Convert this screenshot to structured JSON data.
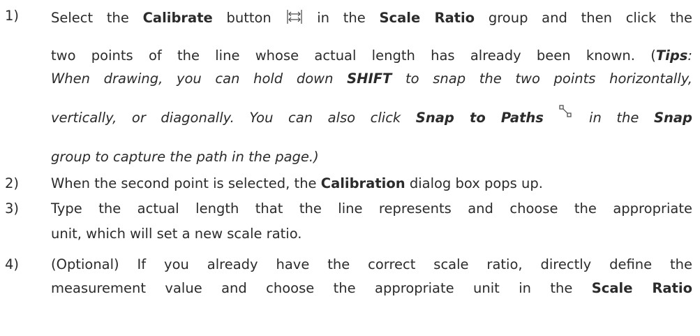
{
  "steps": [
    {
      "number": "1)",
      "line1": {
        "pre": "Select the ",
        "bold1": "Calibrate",
        "mid1": " button",
        "icon": "calibrate-icon",
        "mid2": " in the ",
        "bold2": "Scale Ratio",
        "post": " group and then click the"
      },
      "line2": {
        "text": "two points of the line whose actual length has already been known. (",
        "tips_label": "Tips",
        "tips_colon": ":"
      },
      "line3": {
        "pre": "When drawing, you can hold down ",
        "bold": "SHIFT",
        "post": " to snap the two points horizontally,"
      },
      "line4": {
        "pre": "vertically, or diagonally. You can also click ",
        "bold1": "Snap to Paths",
        "icon": "snap-to-paths-icon",
        "mid": " in the ",
        "bold2": "Snap"
      },
      "line5": {
        "text": "group to capture the path in the page.)"
      }
    },
    {
      "number": "2)",
      "line1": {
        "pre": "When the second point is selected, the ",
        "bold": "Calibration",
        "post": " dialog box pops up."
      }
    },
    {
      "number": "3)",
      "line1": {
        "text": "Type the actual length that the line represents and choose the appropriate"
      },
      "line2": {
        "text": "unit, which will set a new scale ratio."
      }
    },
    {
      "number": "4)",
      "line1": {
        "text": "(Optional) If you already have the correct scale ratio, directly define the"
      },
      "line2": {
        "pre": "measurement value and choose the appropriate unit in the ",
        "bold": "Scale Ratio"
      }
    }
  ]
}
